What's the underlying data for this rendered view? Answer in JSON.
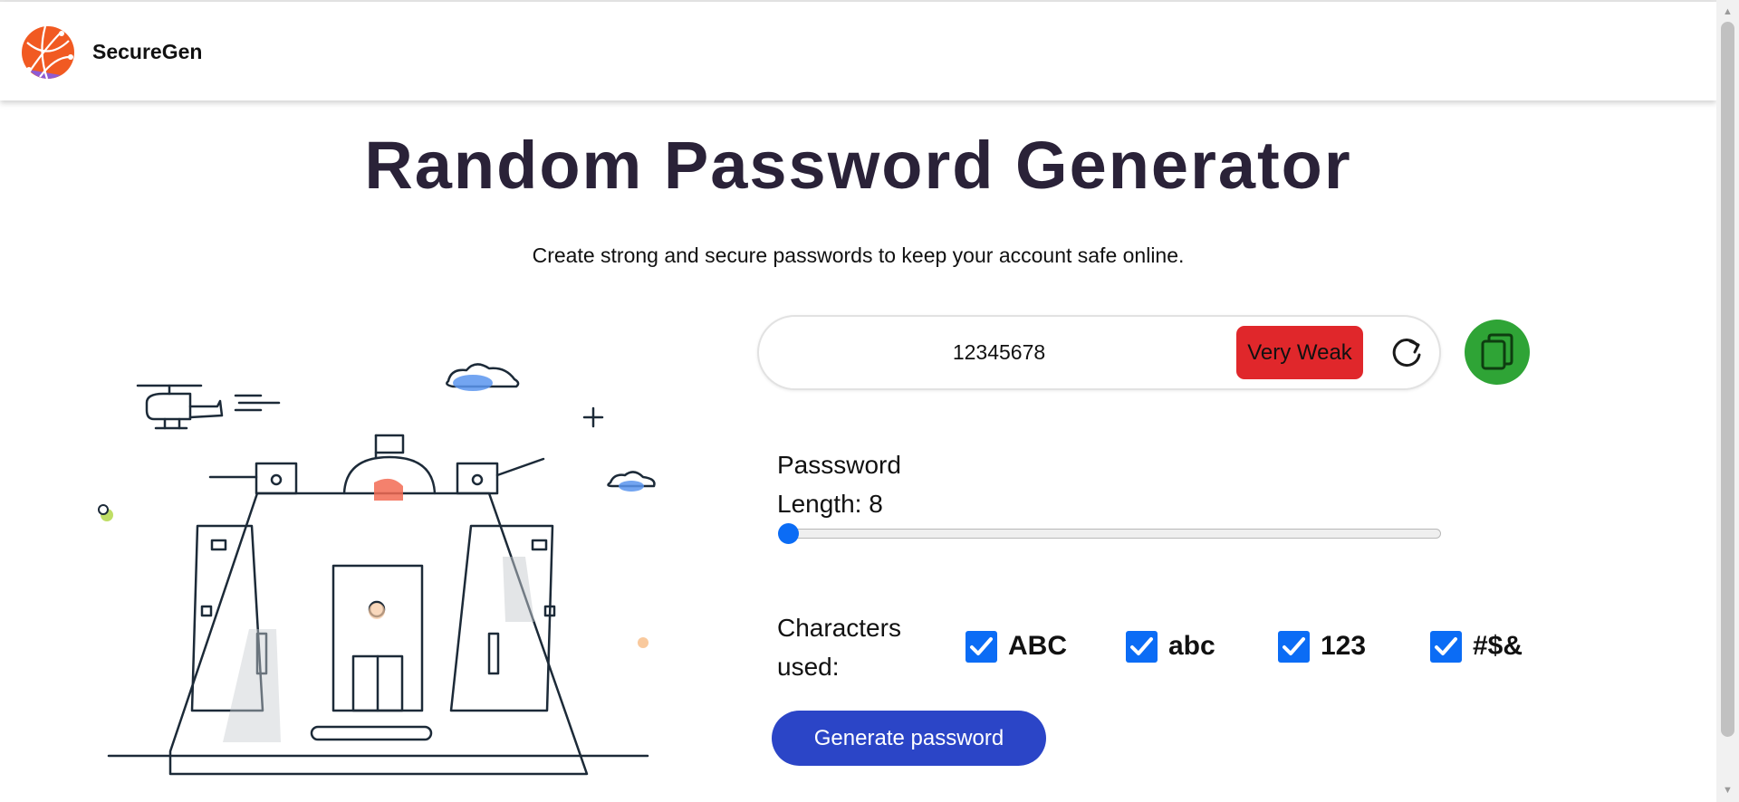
{
  "header": {
    "brand": "SecureGen",
    "logo_icon": "globe-network-logo-icon"
  },
  "hero": {
    "title": "Random Password Generator",
    "subtitle": "Create strong and secure passwords to keep your account safe online."
  },
  "password": {
    "value": "12345678",
    "strength": "Very Weak",
    "strength_color": "#e0272b",
    "refresh_icon": "refresh-icon",
    "copy_icon": "copy-icon",
    "copy_button_color": "#2fa436"
  },
  "length": {
    "label": "Passsword Length: 8",
    "value": 8
  },
  "characters": {
    "label": "Characters used:",
    "options": [
      {
        "label": "ABC",
        "checked": true
      },
      {
        "label": "abc",
        "checked": true
      },
      {
        "label": "123",
        "checked": true
      },
      {
        "label": "#$&",
        "checked": true
      }
    ]
  },
  "generate_button": {
    "label": "Generate password",
    "color": "#2b45c7"
  },
  "colors": {
    "accent": "#0b6cf5",
    "title": "#2a2238"
  }
}
